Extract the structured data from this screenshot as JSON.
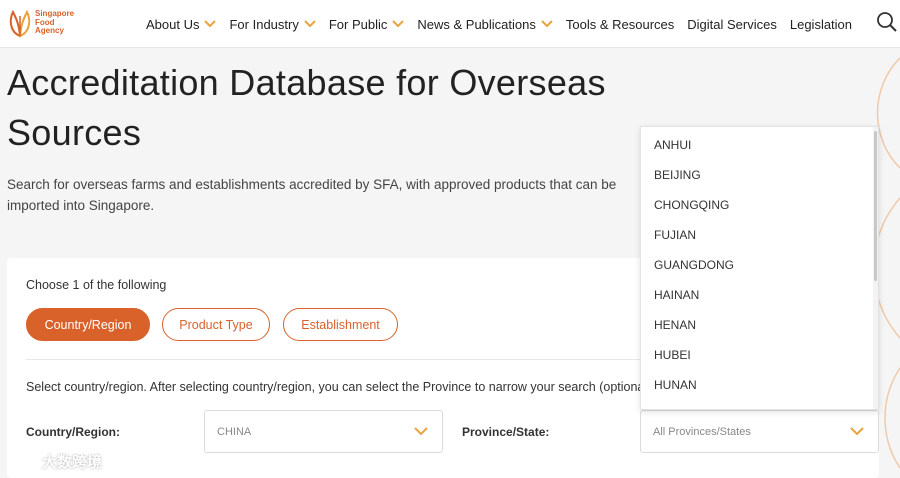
{
  "header": {
    "logo_lines": [
      "Singapore",
      "Food",
      "Agency"
    ],
    "nav": [
      {
        "label": "About Us",
        "has_menu": true
      },
      {
        "label": "For Industry",
        "has_menu": true
      },
      {
        "label": "For Public",
        "has_menu": true
      },
      {
        "label": "News & Publications",
        "has_menu": true
      },
      {
        "label": "Tools & Resources",
        "has_menu": false
      },
      {
        "label": "Digital Services",
        "has_menu": false
      },
      {
        "label": "Legislation",
        "has_menu": false
      }
    ],
    "search_icon": "search-icon"
  },
  "hero": {
    "title": "Accreditation Database for Overseas Sources",
    "description": "Search for overseas farms and establishments accredited by SFA, with approved products that can be imported into Singapore."
  },
  "search_card": {
    "choose_label": "Choose 1 of the following",
    "tabs": [
      {
        "label": "Country/Region",
        "active": true
      },
      {
        "label": "Product Type",
        "active": false
      },
      {
        "label": "Establishment",
        "active": false
      }
    ],
    "help_text": "Select country/region. After selecting country/region, you can select the Province to narrow your search (optional).",
    "country_label": "Country/Region:",
    "country_value": "CHINA",
    "province_label": "Province/State:",
    "province_value": "All Provinces/States"
  },
  "province_dropdown": {
    "options": [
      "ANHUI",
      "BEIJING",
      "CHONGQING",
      "FUJIAN",
      "GUANGDONG",
      "HAINAN",
      "HENAN",
      "HUBEI",
      "HUNAN"
    ]
  },
  "watermark": "大数跨境",
  "colors": {
    "accent": "#d9622b",
    "page_bg": "#f5f5f5",
    "text": "#222222"
  }
}
